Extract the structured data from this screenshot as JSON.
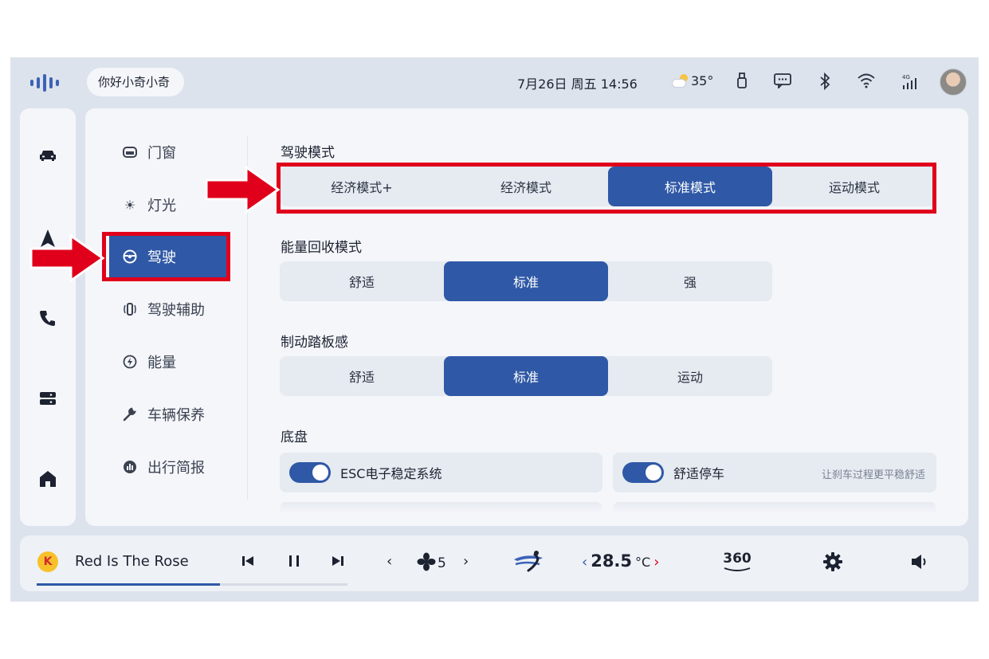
{
  "status_bar": {
    "greeting": "你好小奇小奇",
    "date_time": "7月26日  周五 14:56",
    "temperature": "35°",
    "icons": [
      "usb-icon",
      "message-icon",
      "bluetooth-icon",
      "wifi-icon",
      "signal-4g-icon"
    ],
    "signal_label": "4G"
  },
  "rail": {
    "icons": [
      "car-icon",
      "navigation-icon",
      "phone-icon",
      "apps-icon",
      "home-icon"
    ]
  },
  "menu": {
    "items": [
      {
        "label": "门窗",
        "icon": "window-icon"
      },
      {
        "label": "灯光",
        "icon": "light-icon"
      },
      {
        "label": "驾驶",
        "icon": "steering-wheel-icon",
        "active": true
      },
      {
        "label": "驾驶辅助",
        "icon": "driver-assist-icon"
      },
      {
        "label": "能量",
        "icon": "energy-icon"
      },
      {
        "label": "车辆保养",
        "icon": "wrench-icon"
      },
      {
        "label": "出行简报",
        "icon": "report-icon"
      }
    ]
  },
  "settings": {
    "drive_mode": {
      "title": "驾驶模式",
      "options": [
        "经济模式+",
        "经济模式",
        "标准模式",
        "运动模式"
      ],
      "selected": 2
    },
    "regen": {
      "title": "能量回收模式",
      "options": [
        "舒适",
        "标准",
        "强"
      ],
      "selected": 1
    },
    "brake": {
      "title": "制动踏板感",
      "options": [
        "舒适",
        "标准",
        "运动"
      ],
      "selected": 1
    },
    "chassis": {
      "title": "底盘",
      "esc": {
        "label": "ESC电子稳定系统",
        "on": true
      },
      "comfort_stop": {
        "label": "舒适停车",
        "desc": "让刹车过程更平稳舒适",
        "on": true
      }
    }
  },
  "dock": {
    "app_badge": "K",
    "song": "Red Is The Rose",
    "progress": 0.59,
    "fan_level": "5",
    "temp_value": "28.5",
    "temp_unit": "°C",
    "view_label": "360"
  },
  "colors": {
    "accent": "#2f58a6",
    "highlight": "#e0001b"
  }
}
